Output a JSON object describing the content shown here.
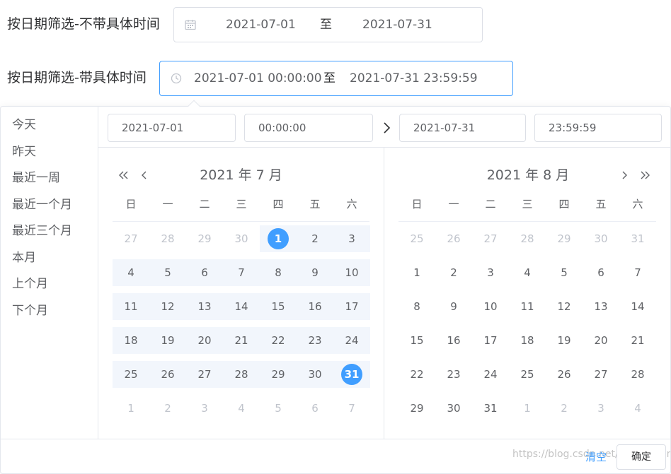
{
  "row1": {
    "label": "按日期筛选-不带具体时间",
    "start": "2021-07-01",
    "separator": "至",
    "end": "2021-07-31",
    "icon": "calendar-icon"
  },
  "row2": {
    "label": "按日期筛选-带具体时间",
    "start": "2021-07-01 00:00:00",
    "separator": "至",
    "end": "2021-07-31 23:59:59",
    "icon": "clock-icon"
  },
  "shortcuts": [
    "今天",
    "昨天",
    "最近一周",
    "最近一个月",
    "最近三个月",
    "本月",
    "上个月",
    "下个月"
  ],
  "header": {
    "start_date": "2021-07-01",
    "start_time": "00:00:00",
    "end_date": "2021-07-31",
    "end_time": "23:59:59"
  },
  "weekdays": [
    "日",
    "一",
    "二",
    "三",
    "四",
    "五",
    "六"
  ],
  "left_calendar": {
    "title": "2021 年 7 月",
    "weeks": [
      [
        "27",
        "28",
        "29",
        "30",
        "1",
        "2",
        "3"
      ],
      [
        "4",
        "5",
        "6",
        "7",
        "8",
        "9",
        "10"
      ],
      [
        "11",
        "12",
        "13",
        "14",
        "15",
        "16",
        "17"
      ],
      [
        "18",
        "19",
        "20",
        "21",
        "22",
        "23",
        "24"
      ],
      [
        "25",
        "26",
        "27",
        "28",
        "29",
        "30",
        "31"
      ],
      [
        "1",
        "2",
        "3",
        "4",
        "5",
        "6",
        "7"
      ]
    ],
    "first_in_month": 4,
    "last_in_month": 34,
    "range_start": 4,
    "range_end": 34,
    "selected": [
      4,
      34
    ]
  },
  "right_calendar": {
    "title": "2021 年 8 月",
    "weeks": [
      [
        "25",
        "26",
        "27",
        "28",
        "29",
        "30",
        "31"
      ],
      [
        "1",
        "2",
        "3",
        "4",
        "5",
        "6",
        "7"
      ],
      [
        "8",
        "9",
        "10",
        "11",
        "12",
        "13",
        "14"
      ],
      [
        "15",
        "16",
        "17",
        "18",
        "19",
        "20",
        "21"
      ],
      [
        "22",
        "23",
        "24",
        "25",
        "26",
        "27",
        "28"
      ],
      [
        "29",
        "30",
        "31",
        "1",
        "2",
        "3",
        "4"
      ]
    ],
    "first_in_month": 7,
    "last_in_month": 37
  },
  "footer": {
    "clear_label": "清空",
    "confirm_label": "确定",
    "watermark": "https://blog.csdn.net/lyyjd0x1an"
  },
  "colors": {
    "accent": "#409eff",
    "range_bg": "#f2f6fc",
    "muted_text": "#c0c4cc",
    "text": "#606266",
    "border": "#dcdfe6"
  }
}
